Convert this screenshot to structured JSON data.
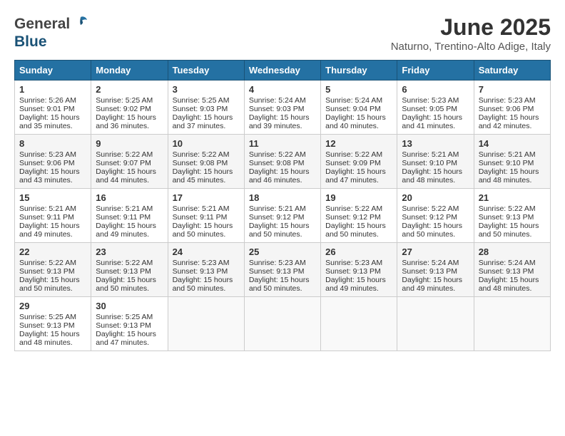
{
  "header": {
    "logo_general": "General",
    "logo_blue": "Blue",
    "month_year": "June 2025",
    "location": "Naturno, Trentino-Alto Adige, Italy"
  },
  "weekdays": [
    "Sunday",
    "Monday",
    "Tuesday",
    "Wednesday",
    "Thursday",
    "Friday",
    "Saturday"
  ],
  "weeks": [
    [
      {
        "day": "1",
        "lines": [
          "Sunrise: 5:26 AM",
          "Sunset: 9:01 PM",
          "Daylight: 15 hours",
          "and 35 minutes."
        ]
      },
      {
        "day": "2",
        "lines": [
          "Sunrise: 5:25 AM",
          "Sunset: 9:02 PM",
          "Daylight: 15 hours",
          "and 36 minutes."
        ]
      },
      {
        "day": "3",
        "lines": [
          "Sunrise: 5:25 AM",
          "Sunset: 9:03 PM",
          "Daylight: 15 hours",
          "and 37 minutes."
        ]
      },
      {
        "day": "4",
        "lines": [
          "Sunrise: 5:24 AM",
          "Sunset: 9:03 PM",
          "Daylight: 15 hours",
          "and 39 minutes."
        ]
      },
      {
        "day": "5",
        "lines": [
          "Sunrise: 5:24 AM",
          "Sunset: 9:04 PM",
          "Daylight: 15 hours",
          "and 40 minutes."
        ]
      },
      {
        "day": "6",
        "lines": [
          "Sunrise: 5:23 AM",
          "Sunset: 9:05 PM",
          "Daylight: 15 hours",
          "and 41 minutes."
        ]
      },
      {
        "day": "7",
        "lines": [
          "Sunrise: 5:23 AM",
          "Sunset: 9:06 PM",
          "Daylight: 15 hours",
          "and 42 minutes."
        ]
      }
    ],
    [
      {
        "day": "8",
        "lines": [
          "Sunrise: 5:23 AM",
          "Sunset: 9:06 PM",
          "Daylight: 15 hours",
          "and 43 minutes."
        ]
      },
      {
        "day": "9",
        "lines": [
          "Sunrise: 5:22 AM",
          "Sunset: 9:07 PM",
          "Daylight: 15 hours",
          "and 44 minutes."
        ]
      },
      {
        "day": "10",
        "lines": [
          "Sunrise: 5:22 AM",
          "Sunset: 9:08 PM",
          "Daylight: 15 hours",
          "and 45 minutes."
        ]
      },
      {
        "day": "11",
        "lines": [
          "Sunrise: 5:22 AM",
          "Sunset: 9:08 PM",
          "Daylight: 15 hours",
          "and 46 minutes."
        ]
      },
      {
        "day": "12",
        "lines": [
          "Sunrise: 5:22 AM",
          "Sunset: 9:09 PM",
          "Daylight: 15 hours",
          "and 47 minutes."
        ]
      },
      {
        "day": "13",
        "lines": [
          "Sunrise: 5:21 AM",
          "Sunset: 9:10 PM",
          "Daylight: 15 hours",
          "and 48 minutes."
        ]
      },
      {
        "day": "14",
        "lines": [
          "Sunrise: 5:21 AM",
          "Sunset: 9:10 PM",
          "Daylight: 15 hours",
          "and 48 minutes."
        ]
      }
    ],
    [
      {
        "day": "15",
        "lines": [
          "Sunrise: 5:21 AM",
          "Sunset: 9:11 PM",
          "Daylight: 15 hours",
          "and 49 minutes."
        ]
      },
      {
        "day": "16",
        "lines": [
          "Sunrise: 5:21 AM",
          "Sunset: 9:11 PM",
          "Daylight: 15 hours",
          "and 49 minutes."
        ]
      },
      {
        "day": "17",
        "lines": [
          "Sunrise: 5:21 AM",
          "Sunset: 9:11 PM",
          "Daylight: 15 hours",
          "and 50 minutes."
        ]
      },
      {
        "day": "18",
        "lines": [
          "Sunrise: 5:21 AM",
          "Sunset: 9:12 PM",
          "Daylight: 15 hours",
          "and 50 minutes."
        ]
      },
      {
        "day": "19",
        "lines": [
          "Sunrise: 5:22 AM",
          "Sunset: 9:12 PM",
          "Daylight: 15 hours",
          "and 50 minutes."
        ]
      },
      {
        "day": "20",
        "lines": [
          "Sunrise: 5:22 AM",
          "Sunset: 9:12 PM",
          "Daylight: 15 hours",
          "and 50 minutes."
        ]
      },
      {
        "day": "21",
        "lines": [
          "Sunrise: 5:22 AM",
          "Sunset: 9:13 PM",
          "Daylight: 15 hours",
          "and 50 minutes."
        ]
      }
    ],
    [
      {
        "day": "22",
        "lines": [
          "Sunrise: 5:22 AM",
          "Sunset: 9:13 PM",
          "Daylight: 15 hours",
          "and 50 minutes."
        ]
      },
      {
        "day": "23",
        "lines": [
          "Sunrise: 5:22 AM",
          "Sunset: 9:13 PM",
          "Daylight: 15 hours",
          "and 50 minutes."
        ]
      },
      {
        "day": "24",
        "lines": [
          "Sunrise: 5:23 AM",
          "Sunset: 9:13 PM",
          "Daylight: 15 hours",
          "and 50 minutes."
        ]
      },
      {
        "day": "25",
        "lines": [
          "Sunrise: 5:23 AM",
          "Sunset: 9:13 PM",
          "Daylight: 15 hours",
          "and 50 minutes."
        ]
      },
      {
        "day": "26",
        "lines": [
          "Sunrise: 5:23 AM",
          "Sunset: 9:13 PM",
          "Daylight: 15 hours",
          "and 49 minutes."
        ]
      },
      {
        "day": "27",
        "lines": [
          "Sunrise: 5:24 AM",
          "Sunset: 9:13 PM",
          "Daylight: 15 hours",
          "and 49 minutes."
        ]
      },
      {
        "day": "28",
        "lines": [
          "Sunrise: 5:24 AM",
          "Sunset: 9:13 PM",
          "Daylight: 15 hours",
          "and 48 minutes."
        ]
      }
    ],
    [
      {
        "day": "29",
        "lines": [
          "Sunrise: 5:25 AM",
          "Sunset: 9:13 PM",
          "Daylight: 15 hours",
          "and 48 minutes."
        ]
      },
      {
        "day": "30",
        "lines": [
          "Sunrise: 5:25 AM",
          "Sunset: 9:13 PM",
          "Daylight: 15 hours",
          "and 47 minutes."
        ]
      },
      {
        "day": "",
        "lines": []
      },
      {
        "day": "",
        "lines": []
      },
      {
        "day": "",
        "lines": []
      },
      {
        "day": "",
        "lines": []
      },
      {
        "day": "",
        "lines": []
      }
    ]
  ]
}
